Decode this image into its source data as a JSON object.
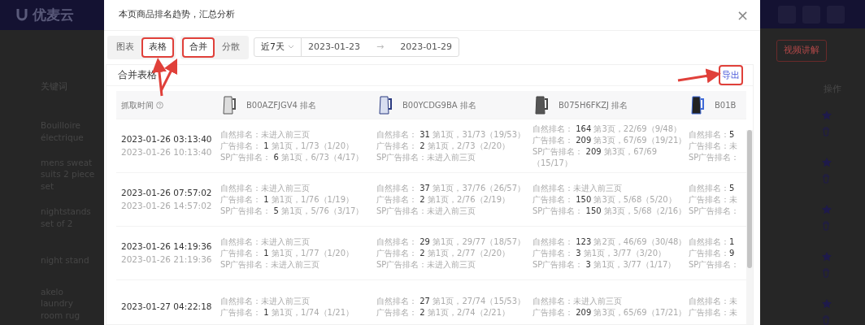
{
  "backdrop": {
    "logo": "优麦云",
    "left_header": "关键词",
    "keywords": [
      "Bouilloire électrique",
      "mens sweat suits 2 piece set",
      "nightstands set of 2",
      "night stand",
      "akelo laundry room rug"
    ],
    "video_button": "视频讲解",
    "right_header": "操作"
  },
  "modal": {
    "title": "本页商品排名趋势，汇总分析",
    "close": "×",
    "view_tabs": [
      {
        "label": "图表",
        "selected": false,
        "annotated": false
      },
      {
        "label": "表格",
        "selected": true,
        "annotated": true
      }
    ],
    "mode_tabs": [
      {
        "label": "合并",
        "selected": true,
        "annotated": true
      },
      {
        "label": "分散",
        "selected": false,
        "annotated": false
      }
    ],
    "period": "近7天",
    "date_from": "2023-01-23",
    "date_arrow": "→",
    "date_to": "2023-01-29",
    "card_title": "合并表格",
    "export": {
      "label": "导出",
      "annotated": true
    },
    "table": {
      "time_header": "抓取时间",
      "columns": [
        "B00AZFJGV4 排名",
        "B00YCDG9BA 排名",
        "B075H6FKZJ 排名",
        "B01B"
      ],
      "rows": [
        {
          "time": "2023-01-26 03:13:40",
          "time2": "2023-01-26 10:13:40",
          "cells": [
            [
              {
                "label": "自然排名：",
                "detail": "未进入前三页"
              },
              {
                "label": "广告排名：",
                "rank": "1",
                "detail": "第1页，1/73（1/20）"
              },
              {
                "label": "SP广告排名：",
                "rank": "6",
                "detail": "第1页，6/73（4/17）"
              }
            ],
            [
              {
                "label": "自然排名：",
                "rank": "31",
                "detail": "第1页，31/73（19/53）"
              },
              {
                "label": "广告排名：",
                "rank": "2",
                "detail": "第1页，2/73（2/20）"
              },
              {
                "label": "SP广告排名：",
                "detail": "未进入前三页"
              }
            ],
            [
              {
                "label": "自然排名：",
                "rank": "164",
                "detail": "第3页，22/69（9/48）"
              },
              {
                "label": "广告排名：",
                "rank": "209",
                "detail": "第3页，67/69（19/21）"
              },
              {
                "label": "SP广告排名：",
                "rank": "209",
                "detail": "第3页，67/69（15/17）"
              }
            ],
            [
              {
                "label": "自然排名：",
                "rank": "5"
              },
              {
                "label": "广告排名：",
                "detail": "未"
              },
              {
                "label": "SP广告排名："
              }
            ]
          ]
        },
        {
          "time": "2023-01-26 07:57:02",
          "time2": "2023-01-26 14:57:02",
          "cells": [
            [
              {
                "label": "自然排名：",
                "detail": "未进入前三页"
              },
              {
                "label": "广告排名：",
                "rank": "1",
                "detail": "第1页，1/76（1/19）"
              },
              {
                "label": "SP广告排名：",
                "rank": "5",
                "detail": "第1页，5/76（3/17）"
              }
            ],
            [
              {
                "label": "自然排名：",
                "rank": "37",
                "detail": "第1页，37/76（26/57）"
              },
              {
                "label": "广告排名：",
                "rank": "2",
                "detail": "第1页，2/76（2/19）"
              },
              {
                "label": "SP广告排名：",
                "detail": "未进入前三页"
              }
            ],
            [
              {
                "label": "自然排名：",
                "detail": "未进入前三页"
              },
              {
                "label": "广告排名：",
                "rank": "150",
                "detail": "第3页，5/68（5/20）"
              },
              {
                "label": "SP广告排名：",
                "rank": "150",
                "detail": "第3页，5/68（2/16）"
              }
            ],
            [
              {
                "label": "自然排名：",
                "rank": "5"
              },
              {
                "label": "广告排名：",
                "detail": "未"
              },
              {
                "label": "SP广告排名："
              }
            ]
          ]
        },
        {
          "time": "2023-01-26 14:19:36",
          "time2": "2023-01-26 21:19:36",
          "cells": [
            [
              {
                "label": "自然排名：",
                "detail": "未进入前三页"
              },
              {
                "label": "广告排名：",
                "rank": "1",
                "detail": "第1页，1/77（1/20）"
              },
              {
                "label": "SP广告排名：",
                "detail": "未进入前三页"
              }
            ],
            [
              {
                "label": "自然排名：",
                "rank": "29",
                "detail": "第1页，29/77（18/57）"
              },
              {
                "label": "广告排名：",
                "rank": "2",
                "detail": "第1页，2/77（2/20）"
              },
              {
                "label": "SP广告排名：",
                "detail": "未进入前三页"
              }
            ],
            [
              {
                "label": "自然排名：",
                "rank": "123",
                "detail": "第2页，46/69（30/48）"
              },
              {
                "label": "广告排名：",
                "rank": "3",
                "detail": "第1页，3/77（3/20）"
              },
              {
                "label": "SP广告排名：",
                "rank": "3",
                "detail": "第1页，3/77（1/17）"
              }
            ],
            [
              {
                "label": "自然排名：",
                "rank": "1"
              },
              {
                "label": "广告排名：",
                "rank": "9"
              },
              {
                "label": "SP广告排名："
              }
            ]
          ]
        },
        {
          "time": "2023-01-27 04:22:18",
          "cells": [
            [
              {
                "label": "自然排名：",
                "detail": "未进入前三页"
              },
              {
                "label": "广告排名：",
                "rank": "1",
                "detail": "第1页，1/74（1/21）"
              }
            ],
            [
              {
                "label": "自然排名：",
                "rank": "27",
                "detail": "第1页，27/74（15/53）"
              },
              {
                "label": "广告排名：",
                "rank": "2",
                "detail": "第1页，2/74（2/21）"
              }
            ],
            [
              {
                "label": "自然排名：",
                "detail": "未进入前三页"
              },
              {
                "label": "广告排名：",
                "rank": "209",
                "detail": "第3页，65/69（17/21）"
              }
            ],
            [
              {
                "label": "自然排名：",
                "detail": "未"
              },
              {
                "label": "广告排名：",
                "detail": "未"
              }
            ]
          ]
        }
      ]
    }
  }
}
